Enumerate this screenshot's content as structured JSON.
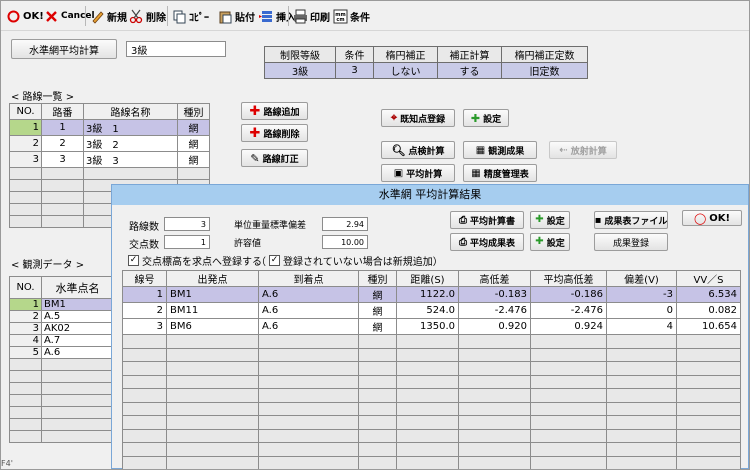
{
  "toolbar": {
    "ok": "OK!",
    "cancel": "Cancel",
    "new": "新規",
    "delete": "削除",
    "copy": "ｺﾋﾟｰ",
    "paste": "貼付",
    "insert": "挿入",
    "print": "印刷",
    "conditions": "条件"
  },
  "header": {
    "calc_button": "水準網平均計算",
    "grade_value": "3級"
  },
  "conditions": {
    "headers": [
      "制限等級",
      "条件",
      "楕円補正",
      "補正計算",
      "楕円補正定数"
    ],
    "values": [
      "3級",
      "3",
      "しない",
      "する",
      "旧定数"
    ]
  },
  "route_section": {
    "title": "< 路線一覧 >",
    "columns": [
      "NO.",
      "路番",
      "路線名称",
      "種別"
    ],
    "rows": [
      {
        "no": "1",
        "ban": "1",
        "name": "3級　1",
        "kind": "網"
      },
      {
        "no": "2",
        "ban": "2",
        "name": "3級　2",
        "kind": "網"
      },
      {
        "no": "3",
        "ban": "3",
        "name": "3級　3",
        "kind": "網"
      }
    ]
  },
  "route_buttons": {
    "add": "路線追加",
    "remove": "路線削除",
    "correct": "路線訂正"
  },
  "right_buttons": {
    "known_point": "既知点登録",
    "settings": "設定",
    "check_calc": "点検計算",
    "obs_result": "観測成果",
    "radiation_calc": "放射計算",
    "average_calc": "平均計算",
    "precision": "精度管理表"
  },
  "obs_section": {
    "title": "< 観測データ >",
    "columns": [
      "NO.",
      "水準点名"
    ],
    "rows": [
      {
        "no": "1",
        "name": "BM1"
      },
      {
        "no": "2",
        "name": "A.5"
      },
      {
        "no": "3",
        "name": "AK02"
      },
      {
        "no": "4",
        "name": "A.7"
      },
      {
        "no": "5",
        "name": "A.6"
      }
    ]
  },
  "results_window": {
    "title": "水準網 平均計算結果",
    "route_count_label": "路線数",
    "route_count": "3",
    "intersection_label": "交点数",
    "intersection_count": "1",
    "std_error_label": "単位重量標準偏差",
    "std_error": "2.94",
    "tolerance_label": "許容値",
    "tolerance": "10.00",
    "buttons": {
      "avg_report": "平均計算書",
      "settings1": "設定",
      "result_sheet_file": "成果表ファイル",
      "ok": "OK!",
      "avg_result": "平均成果表",
      "settings2": "設定",
      "register_result": "成果登録"
    },
    "checkbox1": "交点標高を求点へ登録する",
    "checkbox2": "登録されていない場合は新規追加）",
    "checkbox2_prefix": "（",
    "columns": [
      "線号",
      "出発点",
      "到着点",
      "種別",
      "距離(S)",
      "高低差",
      "平均高低差",
      "偏差(V)",
      "VV／S"
    ],
    "rows": [
      {
        "no": "1",
        "from": "BM1",
        "to": "A.6",
        "kind": "網",
        "dist": "1122.0",
        "diff": "-0.183",
        "avg": "-0.186",
        "dev": "-3",
        "vvs": "6.534"
      },
      {
        "no": "2",
        "from": "BM11",
        "to": "A.6",
        "kind": "網",
        "dist": "524.0",
        "diff": "-2.476",
        "avg": "-2.476",
        "dev": "0",
        "vvs": "0.082"
      },
      {
        "no": "3",
        "from": "BM6",
        "to": "A.6",
        "kind": "網",
        "dist": "1350.0",
        "diff": "0.920",
        "avg": "0.924",
        "dev": "4",
        "vvs": "10.654"
      }
    ]
  },
  "status_fragment": "F4'",
  "colors": {
    "title_bar": "#a6cdef",
    "selected_row": "#c6c3e6",
    "row_header_selected": "#b5d78b",
    "condition_values": "#c9cbe8"
  }
}
